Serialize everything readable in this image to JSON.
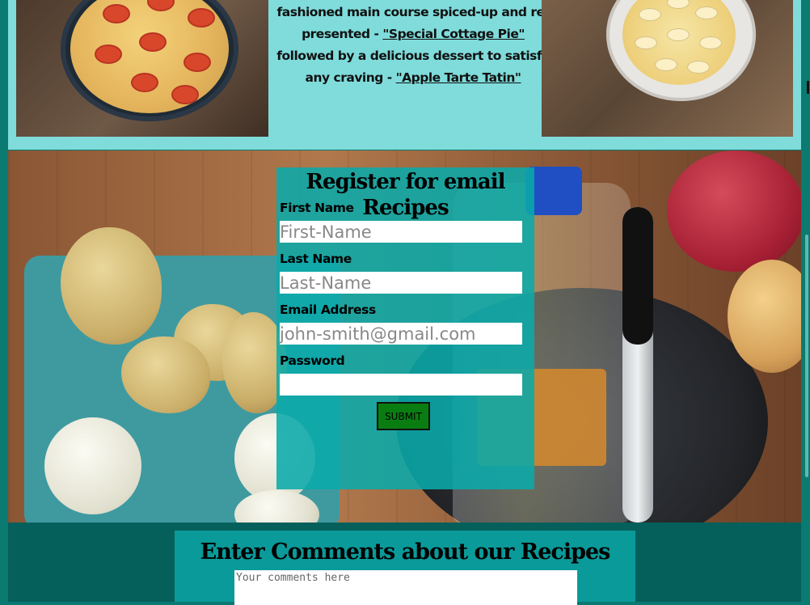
{
  "intro": {
    "line1": "fashioned main course spiced-up and re-",
    "line2_prefix": "presented - ",
    "main_link": "\"Special Cottage Pie\"",
    "line3": "followed by a delicious dessert to satisfy",
    "line4_prefix": "any craving - ",
    "dessert_link": "\"Apple Tarte Tatin\""
  },
  "form": {
    "title": "Register for email Recipes",
    "first_name_label": "First Name",
    "first_name_placeholder": "First-Name",
    "last_name_label": "Last Name",
    "last_name_placeholder": "Last-Name",
    "email_label": "Email Address",
    "email_placeholder": "john-smith@gmail.com",
    "password_label": "Password",
    "submit_label": "SUBMIT"
  },
  "comments": {
    "title": "Enter Comments about our Recipes Here",
    "placeholder": "Your comments here"
  },
  "colors": {
    "top_band": "#7fdcdb",
    "form_bg": "#0aaaaa",
    "submit_bg": "#0a7d12",
    "bottom_band": "#055f5b"
  }
}
